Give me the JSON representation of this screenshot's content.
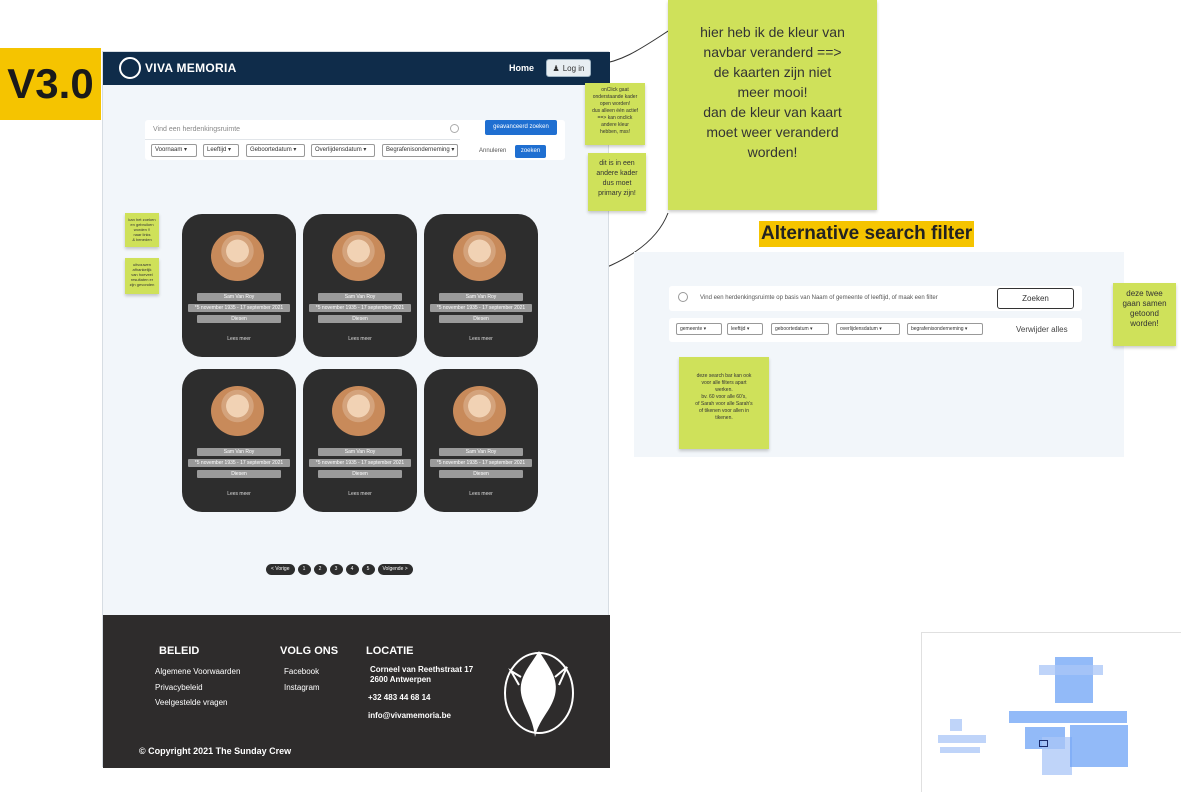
{
  "version_tag": "V3.0",
  "mockup": {
    "navbar": {
      "brand": "VIVA MEMORIA",
      "home": "Home",
      "login": "Log in"
    },
    "search": {
      "placeholder": "Vind een herdenkingsruimte",
      "advanced_button": "geavanceerd zoeken",
      "filters": [
        "Voornaam",
        "Leeftijd",
        "Geboortedatum",
        "Overlijdensdatum",
        "Begrafenisonderneming"
      ],
      "cancel": "Annuleren",
      "search_button": "zoeken"
    },
    "cards": [
      {
        "name": "Sam Van Roy",
        "dates": "*5 november 1935 - 17 september 2021",
        "place": "Diesen",
        "more": "Lees meer"
      },
      {
        "name": "Sam Van Roy",
        "dates": "*5 november 1935 - 17 september 2021",
        "place": "Diesen",
        "more": "Lees meer"
      },
      {
        "name": "Sam Van Roy",
        "dates": "*5 november 1935 - 17 september 2021",
        "place": "Diesen",
        "more": "Lees meer"
      },
      {
        "name": "Sam Van Roy",
        "dates": "*5 november 1935 - 17 september 2021",
        "place": "Diesen",
        "more": "Lees meer"
      },
      {
        "name": "Sam Van Roy",
        "dates": "*5 november 1935 - 17 september 2021",
        "place": "Diesen",
        "more": "Lees meer"
      },
      {
        "name": "Sam Van Roy",
        "dates": "*5 november 1935 - 17 september 2021",
        "place": "Diesen",
        "more": "Lees meer"
      }
    ],
    "pagination": {
      "prev": "< Vorige",
      "pages": [
        "1",
        "2",
        "3",
        "4",
        "5"
      ],
      "next": "Volgende >"
    },
    "footer": {
      "beleid": {
        "title": "BELEID",
        "links": [
          "Algemene Voorwaarden",
          "Privacybeleid",
          "Veelgestelde vragen"
        ]
      },
      "volg": {
        "title": "VOLG ONS",
        "links": [
          "Facebook",
          "Instagram"
        ]
      },
      "locatie": {
        "title": "LOCATIE",
        "address_line1": "Corneel van Reethstraat 17",
        "address_line2": "2600 Antwerpen",
        "phone": "+32 483 44 68 14",
        "email": "info@vivamemoria.be"
      },
      "copyright": "© Copyright 2021 The Sunday Crew"
    }
  },
  "notes": {
    "big": [
      "hier heb ik de kleur van",
      "navbar veranderd ==>",
      "de kaarten zijn niet",
      "meer mooi!",
      "dan de kleur van kaart",
      "moet weer veranderd",
      "worden!"
    ],
    "onclick": [
      "onClick gaat",
      "onderstaande kader",
      "open worden!",
      "dus alleen één actief",
      "==> kan onclick",
      "andere kleur",
      "hebben, mss!"
    ],
    "primary": [
      "dit is in een",
      "andere kader",
      "dus moet",
      "primary zijn!"
    ],
    "left_top": [
      "kan het zoeken",
      "en gebruiken",
      "worden !!",
      "naar links",
      "& beneden"
    ],
    "left_bottom": [
      "uitvouwen",
      "afhankelijk",
      "van hoeveel",
      "resultaten er",
      "zijn gevonden"
    ],
    "together": [
      "deze twee",
      "gaan samen",
      "getoond",
      "worden!"
    ],
    "searchbar": [
      "deze search bar kan ook",
      "voor alle filters apart",
      "werken.",
      "bv. 60 voor alle 60's,",
      "of Sarah voor alle Sarah's",
      "of tikenen voor allen in",
      "tikenen."
    ]
  },
  "alt": {
    "title": "Alternative search filter",
    "placeholder": "Vind een herdenkingsruimte op basis van Naam of gemeente of leeftijd, of maak een filter",
    "button": "Zoeken",
    "filters": [
      "gemeente",
      "leeftijd",
      "geboortedatum",
      "overlijdensdatum",
      "begrafenisonderneming"
    ],
    "clear": "Verwijder alles"
  },
  "colors": {
    "navbar": "#0f2c4a",
    "primary": "#1f6fd1",
    "card": "#2d2d2d",
    "footer": "#2e2c2c",
    "sticky": "#cfe15a",
    "highlight": "#f5c400"
  }
}
